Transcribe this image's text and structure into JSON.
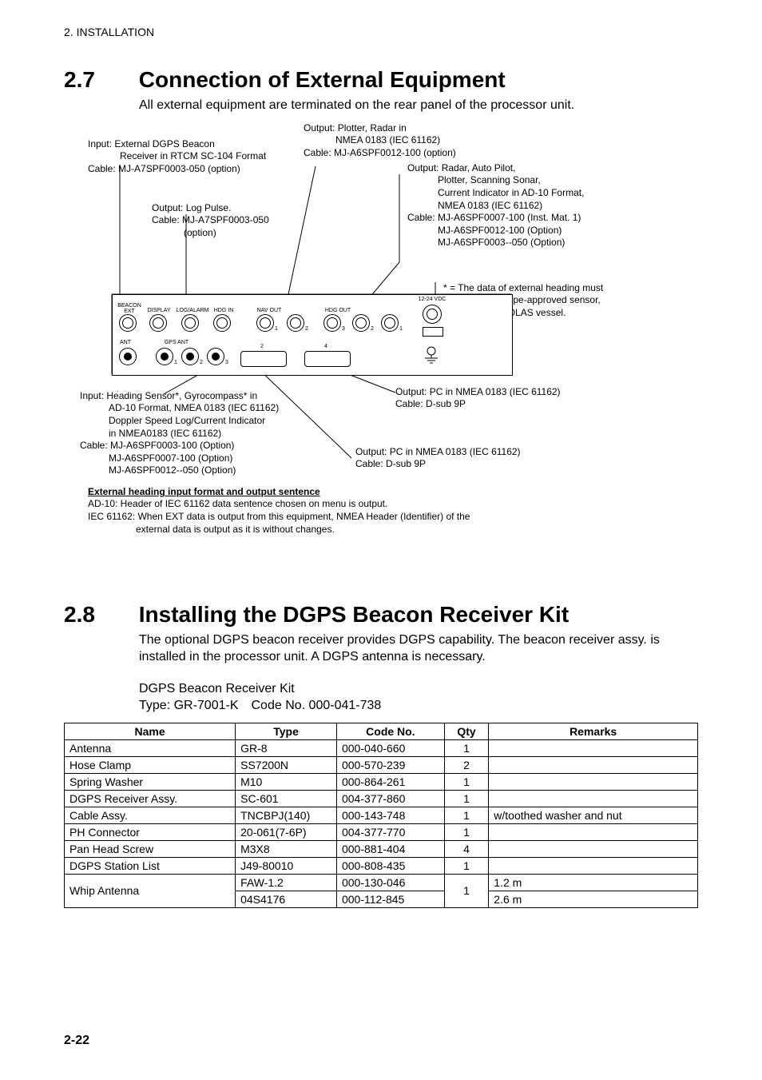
{
  "header": {
    "running": "2. INSTALLATION"
  },
  "section27": {
    "number": "2.7",
    "title": "Connection of External Equipment",
    "intro": "All external equipment are terminated on the rear panel of the processor unit."
  },
  "diagram": {
    "topLeft1": "Input: External DGPS Beacon",
    "topLeft2": "Receiver in RTCM SC-104 Format",
    "topLeft3": "Cable: MJ-A7SPF0003-050 (option)",
    "logPulse1": "Output: Log Pulse.",
    "logPulse2": "Cable: MJ-A7SPF0003-050",
    "logPulse3": "(option)",
    "topMid1": "Output: Plotter, Radar in",
    "topMid2": "NMEA 0183 (IEC 61162)",
    "topMid3": "Cable: MJ-A6SPF0012-100 (option)",
    "topRight1": "Output: Radar, Auto Pilot,",
    "topRight2": "Plotter, Scanning Sonar,",
    "topRight3": "Current Indicator in AD-10 Format,",
    "topRight4": "NMEA 0183 (IEC 61162)",
    "topRight5": "Cable: MJ-A6SPF0007-100 (Inst. Mat. 1)",
    "topRight6": "MJ-A6SPF0012-100 (Option)",
    "topRight7": "MJ-A6SPF0003--050 (Option)",
    "starNote1": "* = The data of external heading must",
    "starNote2": "come from type-approved sensor,",
    "starNote3": "in case of SOLAS vessel.",
    "botLeft1": "Input: Heading Sensor*, Gyrocompass* in",
    "botLeft2": "AD-10 Format, NMEA 0183 (IEC 61162)",
    "botLeft3": "Doppler Speed Log/Current Indicator",
    "botLeft4": "in NMEA0183 (IEC 61162)",
    "botLeft5": "Cable: MJ-A6SPF0003-100 (Option)",
    "botLeft6": "MJ-A6SPF0007-100 (Option)",
    "botLeft7": "MJ-A6SPF0012--050 (Option)",
    "botRight1a": "Output: PC in NMEA 0183 (IEC 61162)",
    "botRight1b": "Cable: D-sub 9P",
    "botRight2a": "Output: PC in NMEA 0183 (IEC 61162)",
    "botRight2b": "Cable: D-sub 9P",
    "panelLabels": {
      "beaconExt": "BEACON\nEXT",
      "display": "DISPLAY",
      "logAlarm": "LOG/ALARM",
      "hdgIn": "HDG IN",
      "navOut": "NAV OUT",
      "hdgOut": "HDG OUT",
      "ant": "ANT",
      "gpsAnt": "GPS ANT",
      "vdc": "12-24 VDC"
    }
  },
  "diagramNotes": {
    "title": "External heading input format and output sentence",
    "line1": "AD-10: Header of IEC 61162 data sentence chosen on menu is output.",
    "line2": "IEC 61162: When EXT data is output from this equipment, NMEA Header (Identifier) of the",
    "line3": "external data is output as it is without changes."
  },
  "section28": {
    "number": "2.8",
    "title": "Installing the DGPS Beacon Receiver Kit",
    "para": "The optional DGPS beacon receiver provides DGPS capability. The beacon receiver assy. is installed in the processor unit. A DGPS antenna is necessary.",
    "kitName": "DGPS Beacon Receiver Kit",
    "kitTypeLine": "Type: GR-7001-K Code No. 000-041-738"
  },
  "tableHeaders": {
    "name": "Name",
    "type": "Type",
    "code": "Code No.",
    "qty": "Qty",
    "remarks": "Remarks"
  },
  "tableRows": [
    {
      "name": "Antenna",
      "type": "GR-8",
      "code": "000-040-660",
      "qty": "1",
      "remarks": ""
    },
    {
      "name": "Hose Clamp",
      "type": "SS7200N",
      "code": "000-570-239",
      "qty": "2",
      "remarks": ""
    },
    {
      "name": "Spring Washer",
      "type": "M10",
      "code": "000-864-261",
      "qty": "1",
      "remarks": ""
    },
    {
      "name": "DGPS Receiver Assy.",
      "type": "SC-601",
      "code": "004-377-860",
      "qty": "1",
      "remarks": ""
    },
    {
      "name": "Cable Assy.",
      "type": "TNCBPJ(140)",
      "code": "000-143-748",
      "qty": "1",
      "remarks": "w/toothed washer and nut"
    },
    {
      "name": "PH Connector",
      "type": "20-061(7-6P)",
      "code": "004-377-770",
      "qty": "1",
      "remarks": ""
    },
    {
      "name": "Pan Head Screw",
      "type": "M3X8",
      "code": "000-881-404",
      "qty": "4",
      "remarks": ""
    },
    {
      "name": "DGPS Station List",
      "type": "J49-80010",
      "code": "000-808-435",
      "qty": "1",
      "remarks": ""
    }
  ],
  "whipRow": {
    "name": "Whip Antenna",
    "type1": "FAW-1.2",
    "code1": "000-130-046",
    "remarks1": "1.2 m",
    "type2": "04S4176",
    "code2": "000-112-845",
    "remarks2": "2.6 m",
    "qty": "1"
  },
  "pageNumber": "2-22"
}
